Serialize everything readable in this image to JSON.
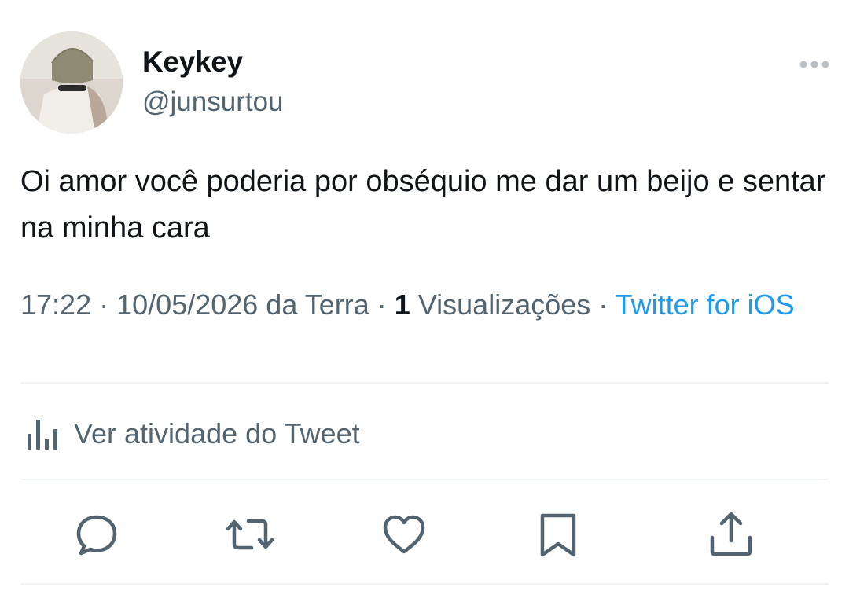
{
  "author": {
    "display_name": "Keykey",
    "handle": "@junsurtou"
  },
  "tweet": {
    "text": "Oi amor você poderia por obséquio me dar um beijo e sentar na minha cara"
  },
  "meta": {
    "time": "17:22",
    "date": "10/05/2026 da Terra",
    "views_count": "1",
    "views_label": "Visualizações",
    "separator": "·",
    "source": "Twitter for iOS"
  },
  "activity": {
    "label": "Ver atividade do Tweet"
  },
  "actions": {
    "icons": [
      "reply-icon",
      "retweet-icon",
      "like-icon",
      "bookmark-icon",
      "share-icon"
    ]
  },
  "colors": {
    "text_primary": "#0f1419",
    "text_secondary": "#536471",
    "link": "#1d9bf0",
    "divider": "#eff3f4"
  }
}
